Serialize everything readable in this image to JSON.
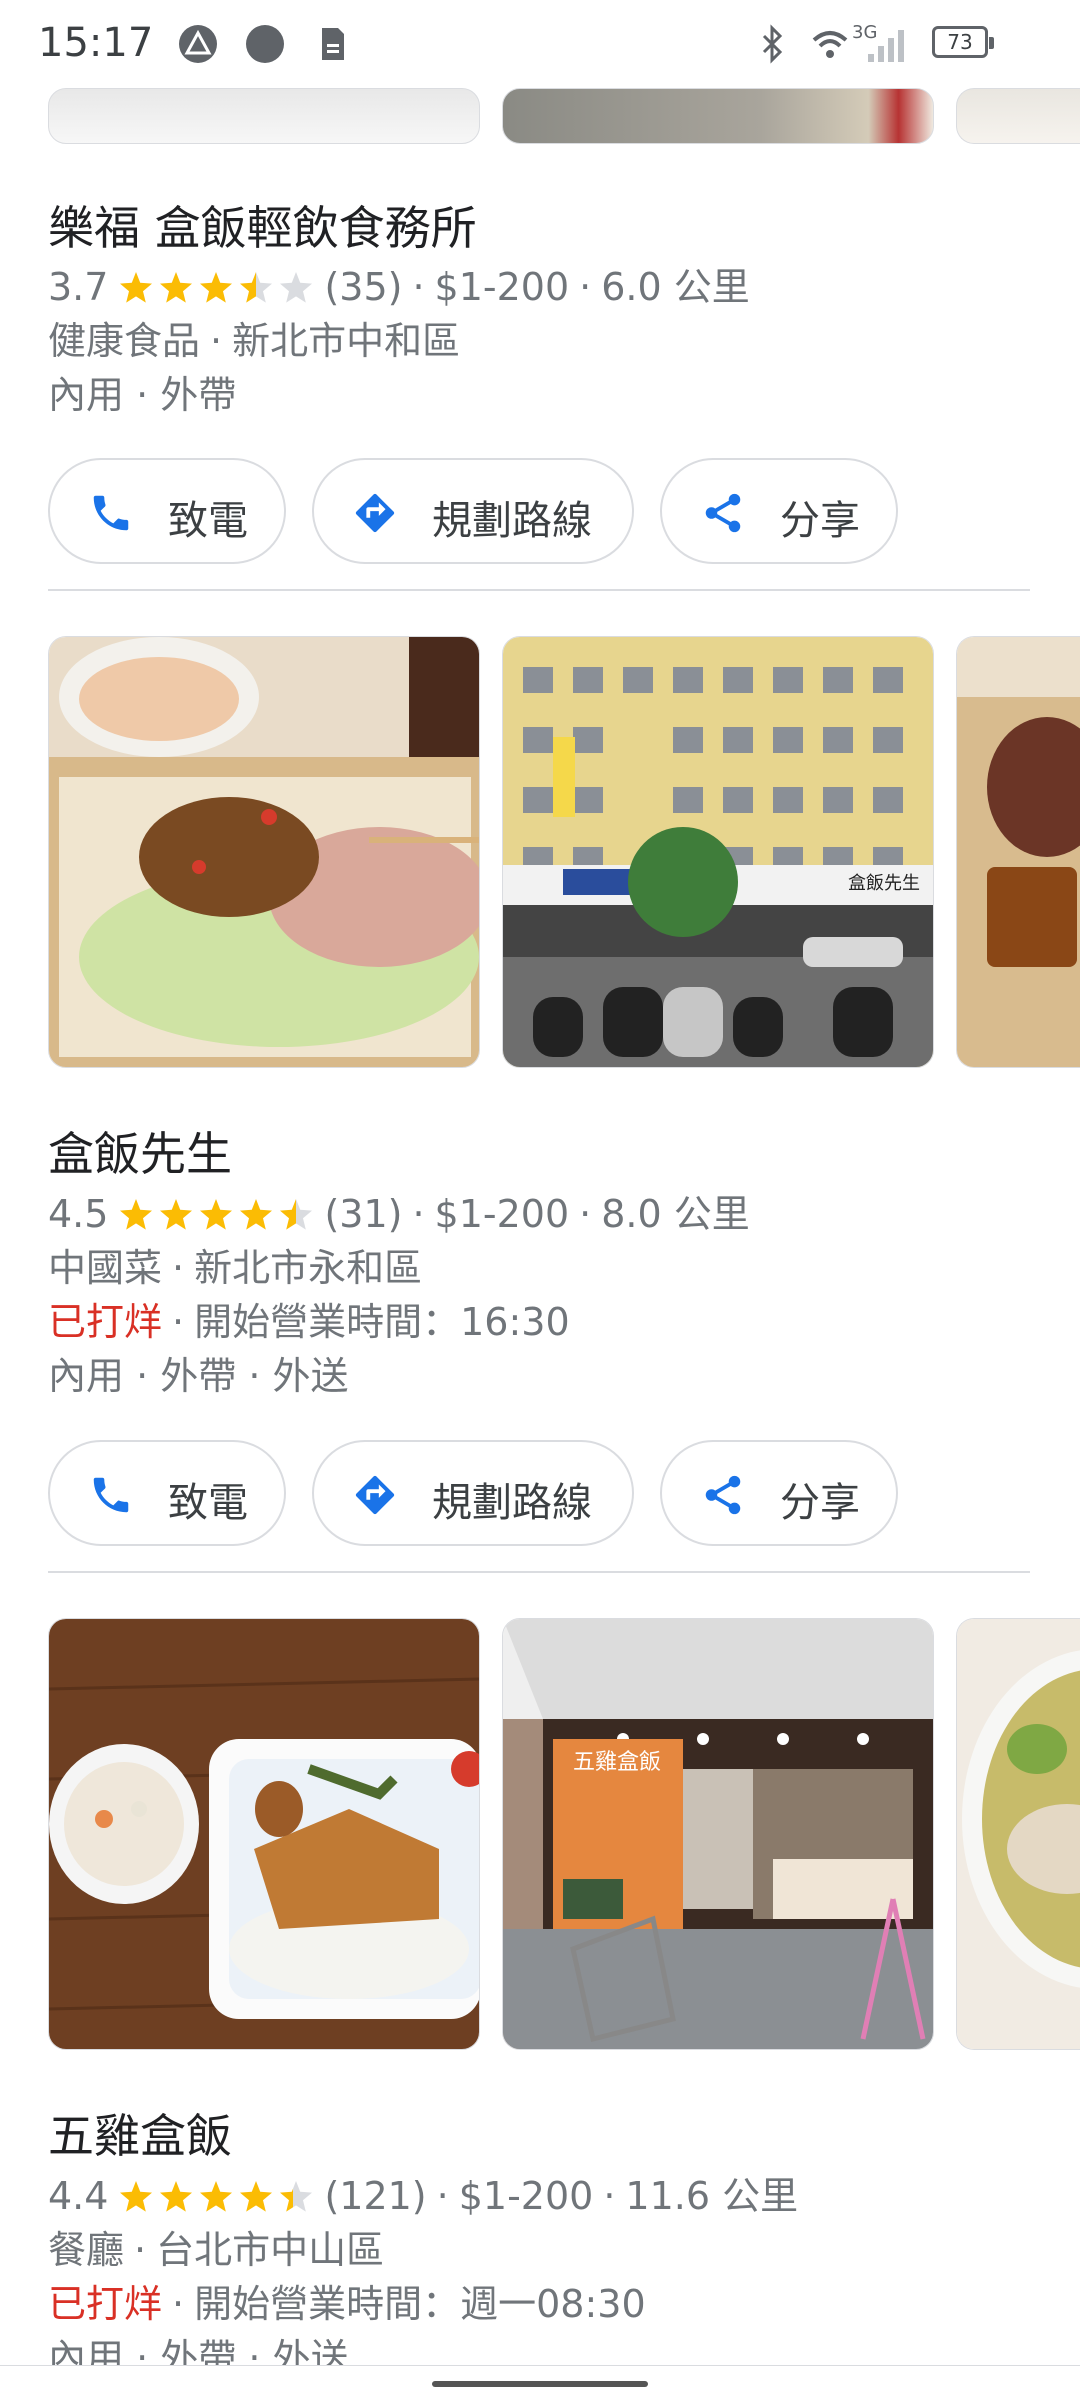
{
  "status": {
    "time": "15:17",
    "battery": "73",
    "network": "3G"
  },
  "places": [
    {
      "name": "樂福 盒飯輕飲食務所",
      "rating": "3.7",
      "reviews": "(35)",
      "price": "$1-200",
      "distance": "6.0 公里",
      "category": "健康食品",
      "area": "新北市中和區",
      "status": "",
      "hours": "",
      "services": "內用 · 外帶"
    },
    {
      "name": "盒飯先生",
      "rating": "4.5",
      "reviews": "(31)",
      "price": "$1-200",
      "distance": "8.0 公里",
      "category": "中國菜",
      "area": "新北市永和區",
      "status": "已打烊",
      "hours": "開始營業時間：16:30",
      "services": "內用 · 外帶 · 外送"
    },
    {
      "name": "五雞盒飯",
      "rating": "4.4",
      "reviews": "(121)",
      "price": "$1-200",
      "distance": "11.6 公里",
      "category": "餐廳",
      "area": "台北市中山區",
      "status": "已打烊",
      "hours": "開始營業時間：週一08:30",
      "services": "內用 · 外帶 · 外送"
    }
  ],
  "actions": {
    "call": "致電",
    "directions": "規劃路線",
    "share": "分享"
  },
  "photo_texts": {
    "sign_1": "盒飯先生",
    "sign_2": "五雞盒飯"
  },
  "colors": {
    "accent": "#1a73e8",
    "star": "#fbbc04",
    "closed": "#d93025",
    "muted": "#70757a"
  }
}
